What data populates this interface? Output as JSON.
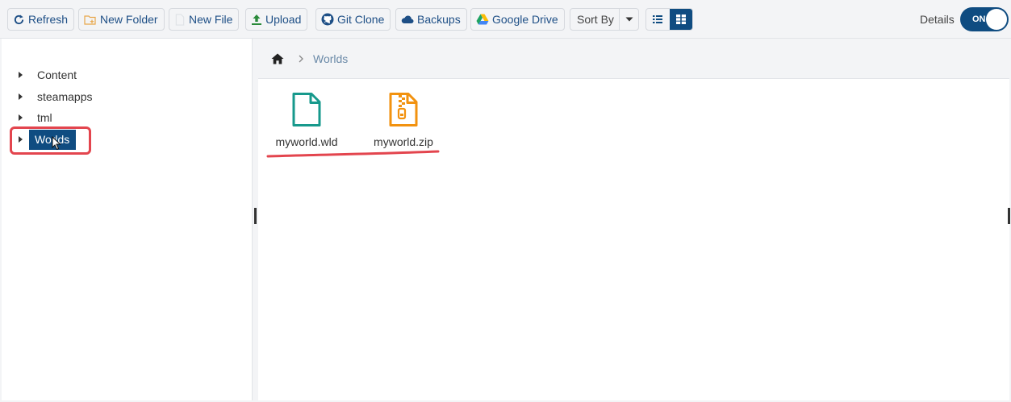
{
  "toolbar": {
    "refresh_label": "Refresh",
    "new_folder_label": "New Folder",
    "new_file_label": "New File",
    "upload_label": "Upload",
    "git_clone_label": "Git Clone",
    "backups_label": "Backups",
    "google_drive_label": "Google Drive",
    "sort_by_label": "Sort By",
    "details_label": "Details",
    "details_toggle_text": "ON"
  },
  "tree": {
    "items": [
      {
        "label": "Content"
      },
      {
        "label": "steamapps"
      },
      {
        "label": "tml"
      },
      {
        "label": "Worlds",
        "selected": true
      }
    ]
  },
  "breadcrumb": {
    "current": "Worlds"
  },
  "files": [
    {
      "name": "myworld.wld",
      "icon": "file-icon"
    },
    {
      "name": "myworld.zip",
      "icon": "zip-file-icon"
    }
  ],
  "colors": {
    "accent": "#0f4c81",
    "highlight": "#e3454e",
    "file_teal": "#17998c",
    "zip_orange": "#f2920f"
  }
}
